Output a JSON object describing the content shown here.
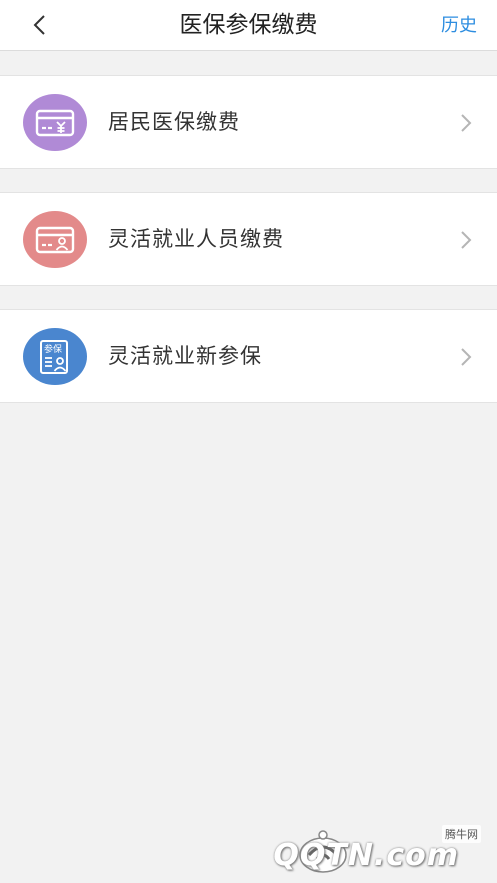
{
  "header": {
    "title": "医保参保缴费",
    "history_label": "历史"
  },
  "colors": {
    "accent": "#2d8de0",
    "icon_purple": "#b08ad6",
    "icon_red": "#e38a8a",
    "icon_blue": "#4a86cf"
  },
  "items": [
    {
      "label": "居民医保缴费",
      "icon": "card-yuan-icon"
    },
    {
      "label": "灵活就业人员缴费",
      "icon": "card-person-icon"
    },
    {
      "label": "灵活就业新参保",
      "icon": "document-enroll-icon",
      "icon_text": "参保"
    }
  ],
  "watermark": {
    "tag": "腾牛网",
    "brand": "QQTN.com"
  }
}
